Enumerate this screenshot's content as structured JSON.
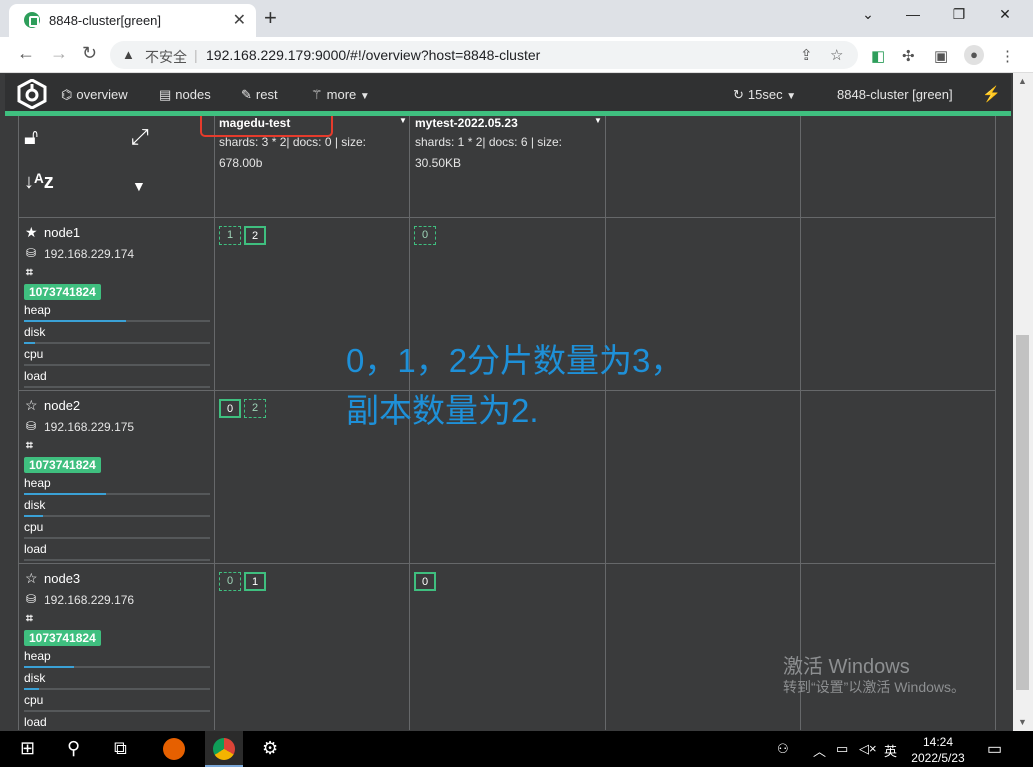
{
  "browser": {
    "tab_title": "8848-cluster[green]",
    "tab_close": "✕",
    "new_tab": "+",
    "minimize": "⌄",
    "restore": "—",
    "maximize": "❐",
    "close": "✕",
    "back": "←",
    "forward": "→",
    "reload": "↻",
    "security_label": "不安全",
    "url": "192.168.229.179:9000/#!/overview?host=8848-cluster"
  },
  "app": {
    "nav": {
      "overview": "overview",
      "nodes": "nodes",
      "rest": "rest",
      "more": "more",
      "refresh": "15sec",
      "cluster": "8848-cluster [green]"
    },
    "indices": [
      {
        "name": "magedu-test",
        "meta_line1": "shards: 3 * 2| docs: 0 | size:",
        "meta_line2": "678.00b"
      },
      {
        "name": "mytest-2022.05.23",
        "meta_line1": "shards: 1 * 2| docs: 6 | size:",
        "meta_line2": "30.50KB"
      }
    ],
    "nodes": [
      {
        "name": "node1",
        "ip": "192.168.229.174",
        "badge": "1073741824",
        "master": true,
        "metrics": {
          "heap": "heap",
          "disk": "disk",
          "cpu": "cpu",
          "load": "load"
        },
        "heap_pct": 0.55,
        "disk_pct": 0.06,
        "shards_col1": [
          {
            "id": "1",
            "type": "replica"
          },
          {
            "id": "2",
            "type": "primary"
          }
        ],
        "shards_col2": [
          {
            "id": "0",
            "type": "replica"
          }
        ]
      },
      {
        "name": "node2",
        "ip": "192.168.229.175",
        "badge": "1073741824",
        "master": false,
        "metrics": {
          "heap": "heap",
          "disk": "disk",
          "cpu": "cpu",
          "load": "load"
        },
        "heap_pct": 0.44,
        "disk_pct": 0.1,
        "shards_col1": [
          {
            "id": "0",
            "type": "primary"
          },
          {
            "id": "2",
            "type": "replica"
          }
        ],
        "shards_col2": []
      },
      {
        "name": "node3",
        "ip": "192.168.229.176",
        "badge": "1073741824",
        "master": false,
        "metrics": {
          "heap": "heap",
          "disk": "disk",
          "cpu": "cpu",
          "load": "load"
        },
        "heap_pct": 0.27,
        "disk_pct": 0.08,
        "shards_col1": [
          {
            "id": "0",
            "type": "replica"
          },
          {
            "id": "1",
            "type": "primary"
          }
        ],
        "shards_col2": [
          {
            "id": "0",
            "type": "primary"
          }
        ]
      }
    ],
    "annotation_line1": "0，1，2分片数量为3，",
    "annotation_line2": "副本数量为2."
  },
  "watermark": {
    "line1": "激活 Windows",
    "line2": "转到“设置”以激活 Windows。"
  },
  "taskbar": {
    "ime": "英",
    "time": "14:24",
    "date": "2022/5/23"
  },
  "colors": {
    "accent": "#3fbf7f",
    "annotation": "#1e90d8",
    "highlight": "#e53b2c"
  }
}
